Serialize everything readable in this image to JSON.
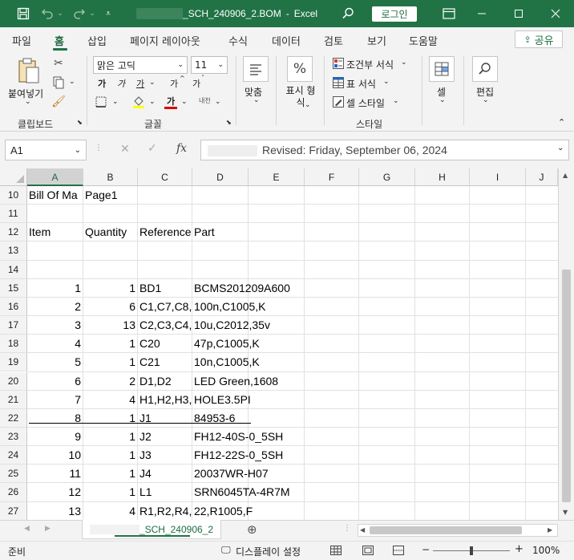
{
  "titlebar": {
    "filename": "_SCH_240906_2.BOM",
    "separator": "-",
    "app": "Excel",
    "login": "로그인"
  },
  "tabs": [
    "파일",
    "홈",
    "삽입",
    "페이지 레이아웃",
    "수식",
    "데이터",
    "검토",
    "보기",
    "도움말"
  ],
  "share": "공유",
  "ribbon": {
    "paste": "붙여넣기",
    "clipboard": "클립보드",
    "font_name": "맑은 고딕",
    "font_size": "11",
    "font_group": "글꼴",
    "font_btn_big": "가",
    "font_btn_small": "가",
    "font_btn_underline": "가",
    "font_btn_color": "가",
    "font_btn_grow": "가",
    "font_btn_shrink": "가",
    "font_btn_phonetic": "내천",
    "align": "맞춤",
    "number_format": "표시 형식",
    "number_symbol": "%",
    "cond_format": "조건부 서식",
    "table_format": "표 서식",
    "cell_style": "셀 스타일",
    "style_group": "스타일",
    "cells": "셀",
    "edit": "편집"
  },
  "namebox": "A1",
  "formula": "Revised: Friday, September 06, 2024",
  "columns": [
    "A",
    "B",
    "C",
    "D",
    "E",
    "F",
    "G",
    "H",
    "I",
    "J"
  ],
  "rows": [
    {
      "n": "10",
      "a": "Bill Of Ma",
      "b": "Page1",
      "c": "",
      "d": ""
    },
    {
      "n": "11",
      "a": "",
      "b": "",
      "c": "",
      "d": ""
    },
    {
      "n": "12",
      "a": "Item",
      "b": "Quantity",
      "c": "Reference",
      "d": "Part"
    },
    {
      "n": "13",
      "a": "",
      "b": "",
      "c": "",
      "d": ""
    },
    {
      "n": "14",
      "a": "",
      "b": "",
      "c": "",
      "d": ""
    },
    {
      "n": "15",
      "a": "1",
      "b": "1",
      "c": "BD1",
      "d": "BCMS201209A600"
    },
    {
      "n": "16",
      "a": "2",
      "b": "6",
      "c": "C1,C7,C8,C",
      "d": "100n,C1005,K"
    },
    {
      "n": "17",
      "a": "3",
      "b": "13",
      "c": "C2,C3,C4,C",
      "d": "10u,C2012,35v"
    },
    {
      "n": "18",
      "a": "4",
      "b": "1",
      "c": "C20",
      "d": "47p,C1005,K"
    },
    {
      "n": "19",
      "a": "5",
      "b": "1",
      "c": "C21",
      "d": "10n,C1005,K"
    },
    {
      "n": "20",
      "a": "6",
      "b": "2",
      "c": "D1,D2",
      "d": "LED Green,1608"
    },
    {
      "n": "21",
      "a": "7",
      "b": "4",
      "c": "H1,H2,H3,",
      "d": "HOLE3.5PI"
    },
    {
      "n": "22",
      "a": "8",
      "b": "1",
      "c": "J1",
      "d": "84953-6"
    },
    {
      "n": "23",
      "a": "9",
      "b": "1",
      "c": "J2",
      "d": "FH12-40S-0_5SH"
    },
    {
      "n": "24",
      "a": "10",
      "b": "1",
      "c": "J3",
      "d": "FH12-22S-0_5SH"
    },
    {
      "n": "25",
      "a": "11",
      "b": "1",
      "c": "J4",
      "d": "20037WR-H07"
    },
    {
      "n": "26",
      "a": "12",
      "b": "1",
      "c": "L1",
      "d": "SRN6045TA-4R7M"
    },
    {
      "n": "27",
      "a": "13",
      "b": "4",
      "c": "R1,R2,R4,F",
      "d": "22,R1005,F"
    }
  ],
  "sheet_tab": "_SCH_240906_2",
  "status": {
    "ready": "준비",
    "display_settings": "디스플레이 설정",
    "zoom": "100%",
    "zoom_minus": "−",
    "zoom_plus": "+"
  }
}
